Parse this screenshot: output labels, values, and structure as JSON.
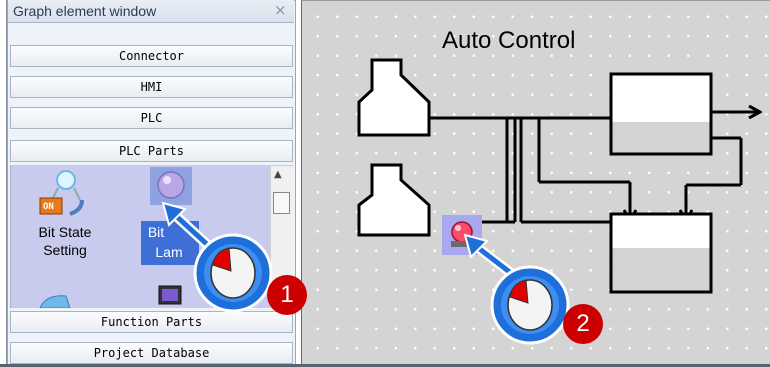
{
  "panel": {
    "title": "Graph element window",
    "close_glyph": "×",
    "categories": [
      "Connector",
      "HMI",
      "PLC",
      "PLC Parts"
    ],
    "parts": [
      {
        "line1": "Bit State",
        "line2": "Setting",
        "icon": "bit-state-setting-icon",
        "badge": "ON"
      },
      {
        "line1": "Bit",
        "line2": "Lam",
        "icon": "bit-lamp-icon",
        "selected": true
      }
    ],
    "bottom_categories": [
      "Function Parts",
      "Project Database"
    ],
    "scroll_up_glyph": "▲"
  },
  "canvas": {
    "title": "Auto Control",
    "lamp_icon": "red-lamp-icon"
  },
  "steps": [
    {
      "number": "1",
      "icon": "mouse-click-icon"
    },
    {
      "number": "2",
      "icon": "mouse-click-icon"
    }
  ],
  "colors": {
    "selection": "#3d6fd6",
    "parts_bg": "#c9cbee",
    "badge": "#cc0000",
    "mouse_ring": "#1e6fd9"
  }
}
